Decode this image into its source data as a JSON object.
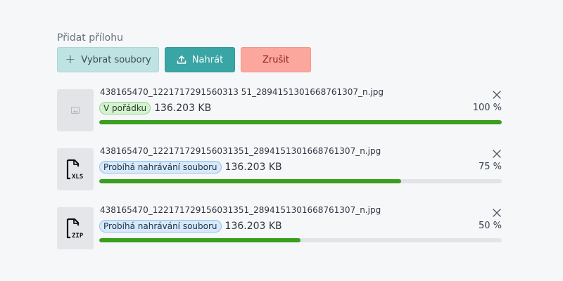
{
  "header": {
    "title": "Přidat přílohu"
  },
  "toolbar": {
    "select_label": "Vybrat soubory",
    "upload_label": "Nahrát",
    "cancel_label": "Zrušit"
  },
  "files": [
    {
      "name": "438165470_1221717291560313 51_2894151301668761307_n.jpg",
      "status": "V pořádku",
      "status_type": "ok",
      "size": "136.203 KB",
      "progress_label": "100 %",
      "progress": 100,
      "icon": "image-icon"
    },
    {
      "name": "438165470_122171729156031351_2894151301668761307_n.jpg",
      "status": "Probíhá nahrávání souboru",
      "status_type": "uploading",
      "size": "136.203 KB",
      "progress_label": "75 %",
      "progress": 75,
      "icon": "xls-file-icon"
    },
    {
      "name": "438165470_122171729156031351_2894151301668761307_n.jpg",
      "status": "Probíhá nahrávání souboru",
      "status_type": "uploading",
      "size": "136.203 KB",
      "progress_label": "50 %",
      "progress": 50,
      "icon": "zip-file-icon"
    }
  ],
  "colors": {
    "progress": "#3a9e1f",
    "track": "#e3e4e8",
    "upload_button": "#3aa5a5",
    "select_button": "#bfe3e3",
    "cancel_button": "#fca79e"
  }
}
